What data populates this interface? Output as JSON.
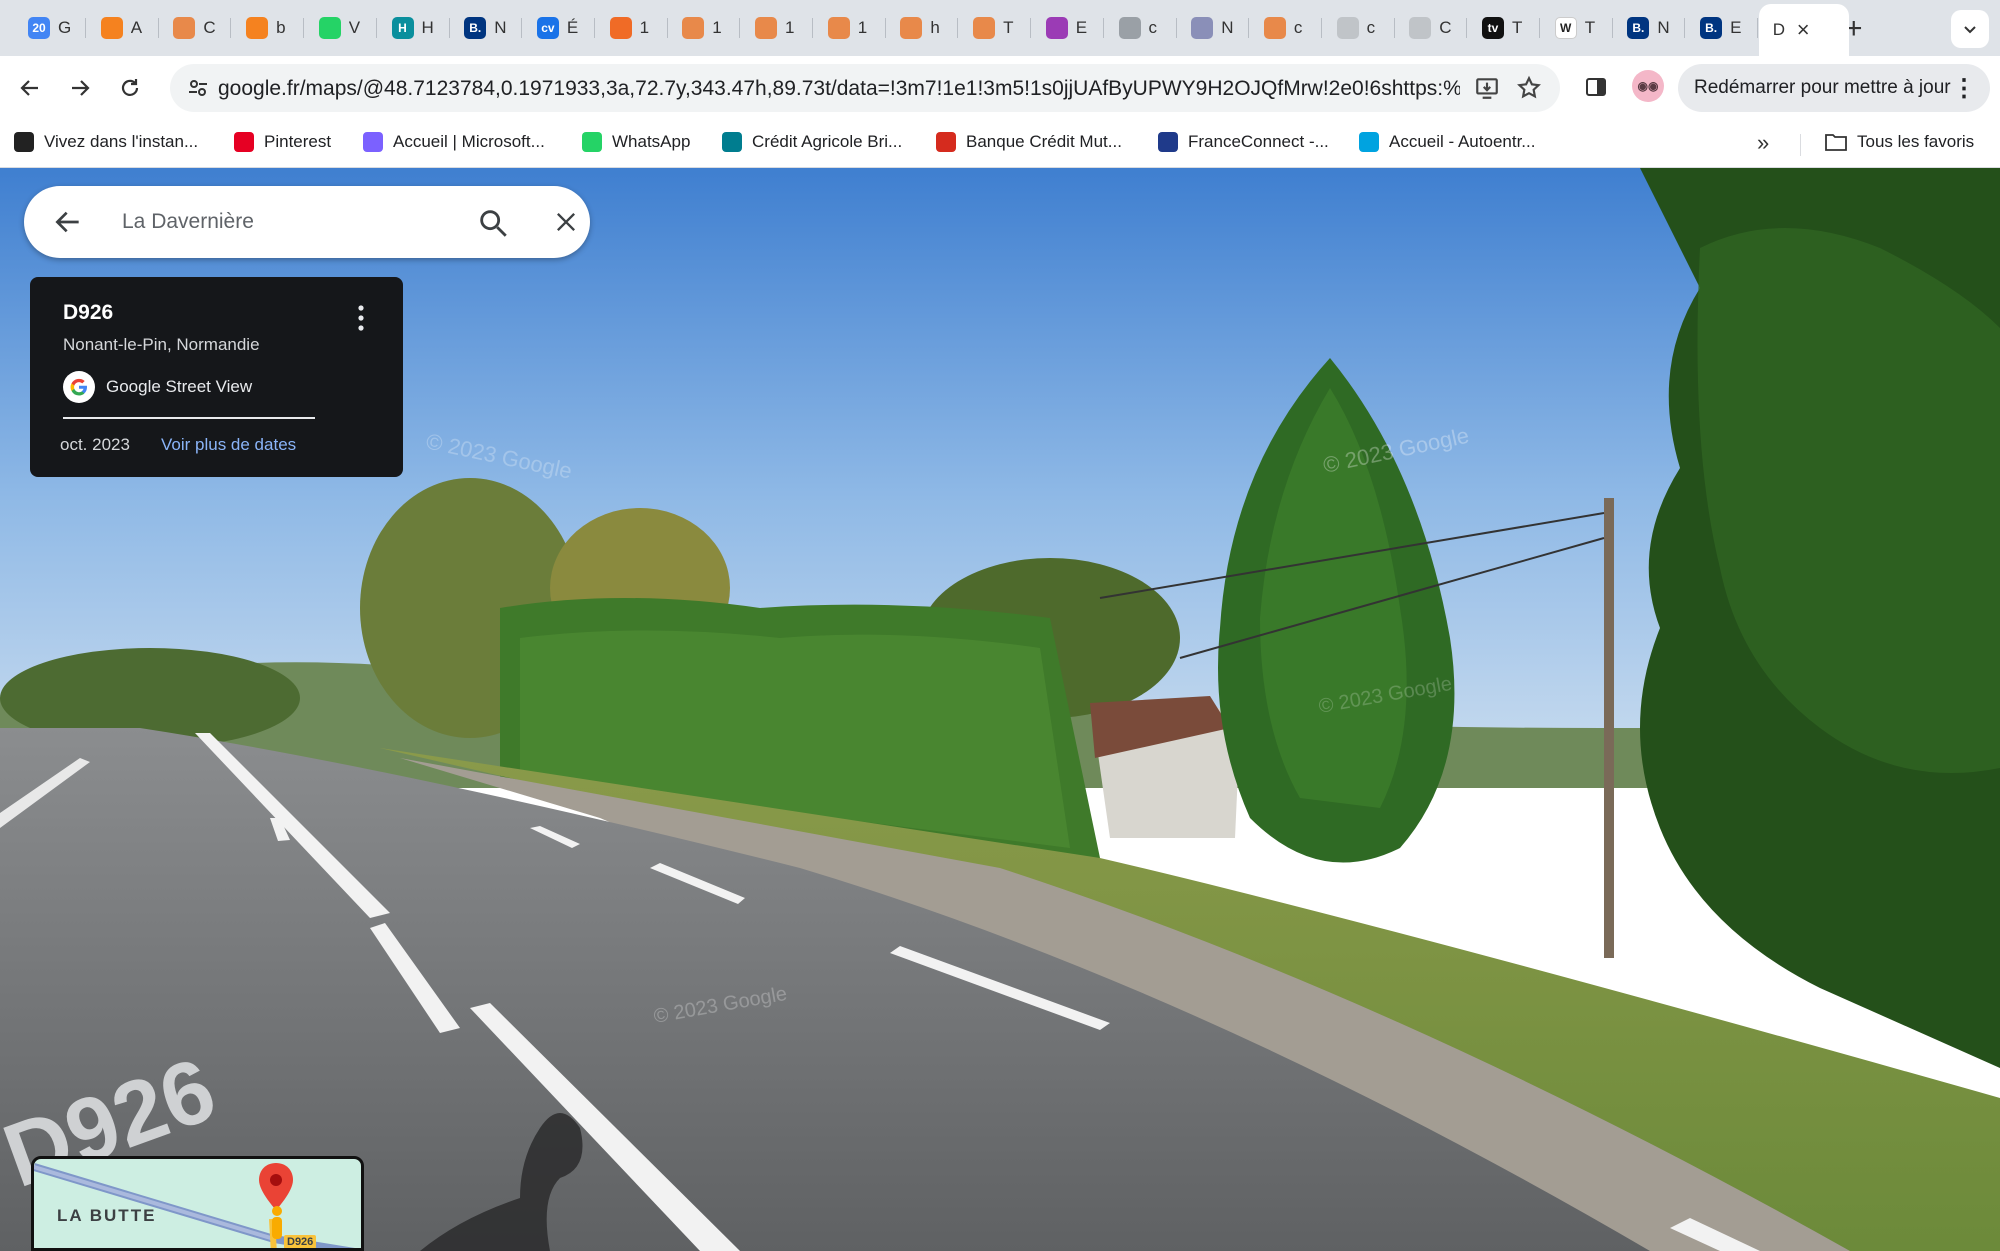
{
  "browser": {
    "tabs": [
      {
        "letter": "G",
        "icon": "calendar-icon",
        "color": "#4285f4",
        "glyph": "20"
      },
      {
        "letter": "A",
        "icon": "orange-square-icon",
        "color": "#f5821f",
        "glyph": ""
      },
      {
        "letter": "C",
        "icon": "orange-circle-icon",
        "color": "#e8894a",
        "glyph": ""
      },
      {
        "letter": "b",
        "icon": "orange-square-icon",
        "color": "#f5821f",
        "glyph": ""
      },
      {
        "letter": "V",
        "icon": "whatsapp-icon",
        "color": "#25d366",
        "glyph": ""
      },
      {
        "letter": "H",
        "icon": "teal-h-icon",
        "color": "#0a8f9d",
        "glyph": "H"
      },
      {
        "letter": "N",
        "icon": "booking-icon",
        "color": "#003580",
        "glyph": "B."
      },
      {
        "letter": "É",
        "icon": "cv-icon",
        "color": "#1a73e8",
        "glyph": "cv"
      },
      {
        "letter": "1",
        "icon": "orange-badge-icon",
        "color": "#f06b26",
        "glyph": ""
      },
      {
        "letter": "1",
        "icon": "orange-circle-icon",
        "color": "#e8894a",
        "glyph": ""
      },
      {
        "letter": "1",
        "icon": "orange-circle-icon",
        "color": "#e8894a",
        "glyph": ""
      },
      {
        "letter": "1",
        "icon": "orange-circle-icon",
        "color": "#e8894a",
        "glyph": ""
      },
      {
        "letter": "h",
        "icon": "orange-circle-icon",
        "color": "#e8894a",
        "glyph": ""
      },
      {
        "letter": "T",
        "icon": "orange-circle-icon",
        "color": "#e8894a",
        "glyph": ""
      },
      {
        "letter": "E",
        "icon": "purple-circle-icon",
        "color": "#9b3bb5",
        "glyph": ""
      },
      {
        "letter": "c",
        "icon": "gray-circle-icon",
        "color": "#9aa0a6",
        "glyph": ""
      },
      {
        "letter": "N",
        "icon": "gray-circle-icon",
        "color": "#8a8fb8",
        "glyph": ""
      },
      {
        "letter": "c",
        "icon": "orange-circle-icon",
        "color": "#e8894a",
        "glyph": ""
      },
      {
        "letter": "c",
        "icon": "google-icon",
        "color": "#c0c4c8",
        "glyph": ""
      },
      {
        "letter": "C",
        "icon": "drive-icon",
        "color": "#c0c4c8",
        "glyph": ""
      },
      {
        "letter": "T",
        "icon": "tv-icon",
        "color": "#111111",
        "glyph": "tv"
      },
      {
        "letter": "T",
        "icon": "wikipedia-icon",
        "color": "#ffffff",
        "glyph": "W"
      },
      {
        "letter": "N",
        "icon": "booking-icon",
        "color": "#003580",
        "glyph": "B."
      },
      {
        "letter": "E",
        "icon": "booking-icon",
        "color": "#003580",
        "glyph": "B."
      },
      {
        "letter": "D",
        "icon": "maps-icon",
        "color": "#ffffff",
        "glyph": ""
      }
    ],
    "url": "google.fr/maps/@48.7123784,0.1971933,3a,72.7y,343.47h,89.73t/data=!3m7!1e1!3m5!1s0jjUAfByUPWY9H2OJQfMrw!2e0!6shttps:%...",
    "restart_label": "Redémarrer pour mettre à jour",
    "bookmarks": [
      {
        "label": "Vivez dans l'instan...",
        "icon": "news-icon",
        "color": "#222222"
      },
      {
        "label": "Pinterest",
        "icon": "pinterest-icon",
        "color": "#e60023"
      },
      {
        "label": "Accueil | Microsoft...",
        "icon": "microsoft-icon",
        "color": "#7b61ff"
      },
      {
        "label": "WhatsApp",
        "icon": "whatsapp-icon",
        "color": "#25d366"
      },
      {
        "label": "Crédit Agricole Bri...",
        "icon": "credit-agricole-icon",
        "color": "#007d8f"
      },
      {
        "label": "Banque Crédit Mut...",
        "icon": "credit-mutuel-icon",
        "color": "#d52b1e"
      },
      {
        "label": "FranceConnect -...",
        "icon": "franceconnect-icon",
        "color": "#1f3a8a"
      },
      {
        "label": "Accueil - Autoentr...",
        "icon": "autoentrepreneur-icon",
        "color": "#00a3e0"
      }
    ],
    "all_favorites_label": "Tous les favoris"
  },
  "maps": {
    "search_value": "La Davernière",
    "card": {
      "title": "D926",
      "subtitle": "Nonant-le-Pin, Normandie",
      "source": "Google Street View",
      "date": "oct. 2023",
      "more_dates_link": "Voir plus de dates"
    },
    "minimap": {
      "place_label": "LA BUTTE",
      "road_label": "D926"
    },
    "watermarks": [
      "© 2023 Google",
      "© 2023 Google",
      "© 2023 Google",
      "© 2023 Google"
    ],
    "road_marking": "D926"
  },
  "colors": {
    "accent_link": "#8ab4f8",
    "card_bg": "#15171a",
    "pin_red": "#ea4335"
  }
}
